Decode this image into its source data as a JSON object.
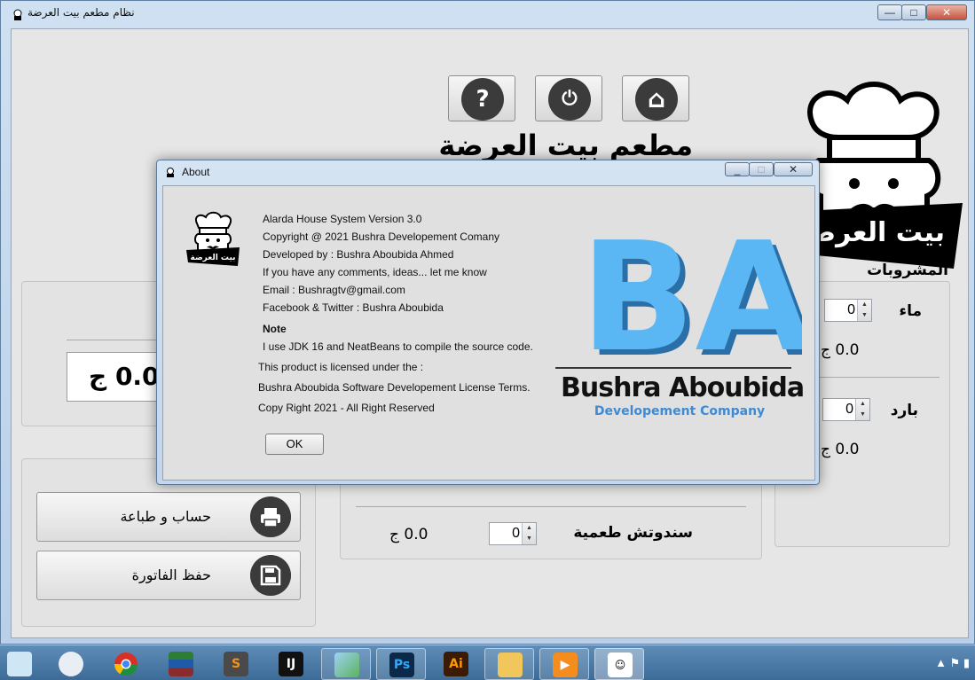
{
  "main_window": {
    "title": "نظام مطعم بيت العرضة",
    "controls": {
      "minimize": "—",
      "maximize": "□",
      "close": "✕"
    }
  },
  "toolbar": {
    "help_icon": "?",
    "power_icon": "⏻",
    "home_icon": "⌂"
  },
  "restaurant_title": "مطعم بيت العرضة",
  "brand_label": "بيت العرضة",
  "total": {
    "value": "0.0 ج"
  },
  "actions": {
    "calc_print": "حساب و طباعة",
    "save_invoice": "حفظ الفاتورة"
  },
  "drinks": {
    "header": "المشروبات",
    "items": [
      {
        "label": "ماء",
        "qty": "0",
        "price": "0.0 ج"
      },
      {
        "label": "بارد",
        "qty": "0",
        "price": "0.0 ج"
      }
    ]
  },
  "food": {
    "items": [
      {
        "label": "سندوتش طعمية",
        "qty": "0",
        "price": "0.0 ج"
      }
    ]
  },
  "about": {
    "title": "About",
    "lines": [
      "Alarda House System Version 3.0",
      "Copyright @ 2021 Bushra Developement Comany",
      "Developed by : Bushra Aboubida Ahmed",
      "If you have any comments, ideas... let me know",
      "Email : Bushragtv@gmail.com",
      "Facebook & Twitter : Bushra Aboubida"
    ],
    "note_title": "Note",
    "note_text": "I use JDK 16 and NeatBeans to compile the source code.",
    "license_lines": [
      "This product is licensed under the :",
      "Bushra Aboubida Software Developement License Terms.",
      "Copy Right 2021 - All Right Reserved"
    ],
    "ok_label": "OK",
    "logo_label": "بيت العرضة",
    "ba_letters": "BA",
    "ba_name": "Bushra Aboubida",
    "ba_sub": "Developement Company"
  },
  "colors": {
    "ba_blue": "#5bb7f3",
    "accent": "#3d8bd6"
  },
  "taskbar": {
    "items": [
      {
        "name": "notepad",
        "icon": "notepad-icon"
      },
      {
        "name": "snipping",
        "icon": "scissors-icon"
      },
      {
        "name": "chrome",
        "icon": "chrome-icon"
      },
      {
        "name": "books",
        "icon": "books-icon"
      },
      {
        "name": "sublime",
        "icon": "sublime-icon"
      },
      {
        "name": "intellij",
        "icon": "intellij-icon"
      },
      {
        "name": "virtualbox",
        "icon": "cube-icon"
      },
      {
        "name": "photoshop",
        "icon": "photoshop-icon"
      },
      {
        "name": "illustrator",
        "icon": "illustrator-icon"
      },
      {
        "name": "explorer",
        "icon": "folder-icon"
      },
      {
        "name": "media",
        "icon": "play-icon"
      },
      {
        "name": "chef-app",
        "icon": "chef-icon"
      }
    ],
    "ps_text": "Ps",
    "ai_text": "Ai",
    "ij_text": "IJ"
  }
}
